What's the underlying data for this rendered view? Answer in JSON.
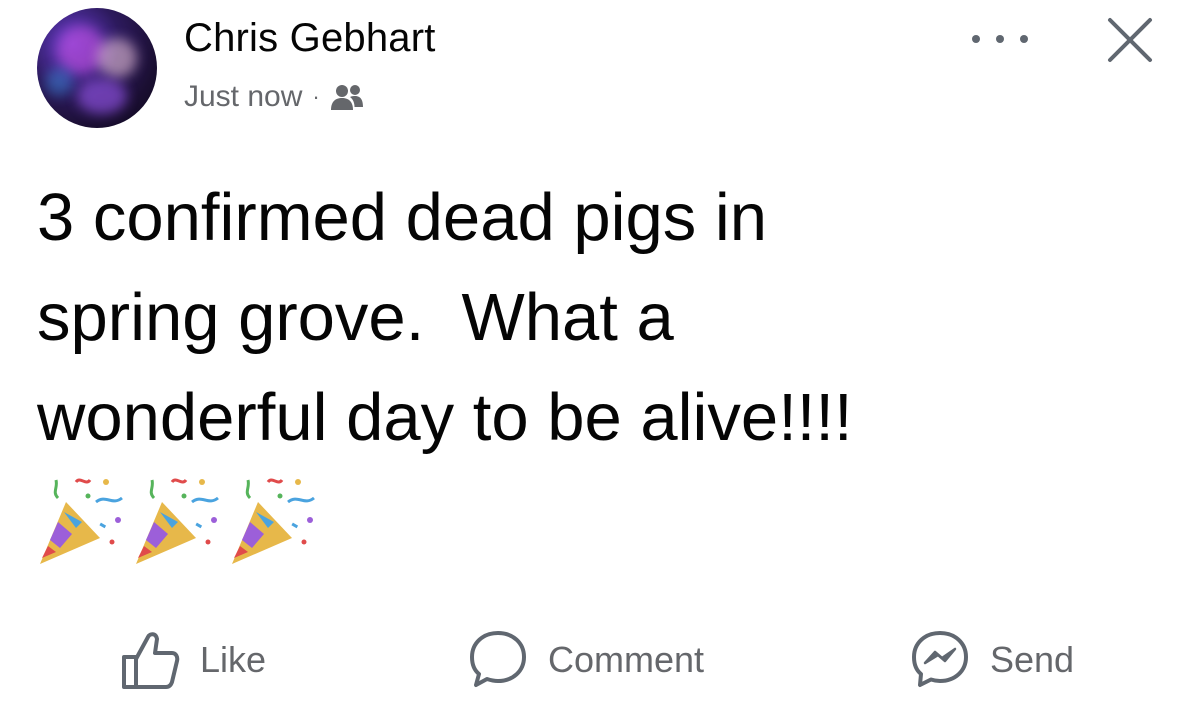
{
  "post": {
    "author": "Chris Gebhart",
    "timestamp": "Just now",
    "separator": "·",
    "audience_icon": "friends-icon",
    "text": "3 confirmed dead pigs in\nspring grove.  What a\nwonderful day to be alive!!!!",
    "emojis": [
      "party-popper",
      "party-popper",
      "party-popper"
    ]
  },
  "header_controls": {
    "more_icon": "more-options-icon",
    "close_icon": "close-icon"
  },
  "actions": {
    "like": "Like",
    "comment": "Comment",
    "send": "Send"
  },
  "colors": {
    "text_primary": "#050505",
    "text_secondary": "#65676b",
    "background": "#ffffff"
  }
}
